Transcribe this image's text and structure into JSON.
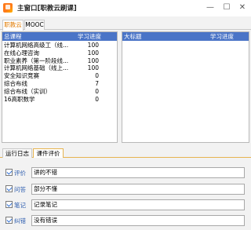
{
  "window": {
    "title": "主窗口[职教云刷课]",
    "controls": {
      "minimize": "—",
      "maximize": "☐",
      "close": "✕"
    }
  },
  "top_tabs": [
    {
      "label": "职教云",
      "active": true
    },
    {
      "label": "MOOC",
      "active": false
    }
  ],
  "course_table": {
    "columns": [
      "总课程",
      "学习进度"
    ],
    "rows": [
      {
        "name": "计算机网络高级工（线...",
        "progress": "100"
      },
      {
        "name": "在线心理咨询",
        "progress": "100"
      },
      {
        "name": "职业素养（第一阶段线...",
        "progress": "100"
      },
      {
        "name": "计算机网络基础（线上...",
        "progress": "100"
      },
      {
        "name": "安全知识竞赛",
        "progress": "0"
      },
      {
        "name": "综合布线",
        "progress": "7"
      },
      {
        "name": "综合布线（实训）",
        "progress": "0"
      },
      {
        "name": "16高职数学",
        "progress": "0"
      }
    ]
  },
  "chapter_table": {
    "columns": [
      "大标题",
      "学习进度"
    ]
  },
  "bottom_tabs": [
    {
      "label": "运行日志",
      "active": false
    },
    {
      "label": "课件评价",
      "active": true
    }
  ],
  "evaluation": [
    {
      "label": "评价",
      "checked": true,
      "value": "讲的不错"
    },
    {
      "label": "问答",
      "checked": true,
      "value": "部分不懂"
    },
    {
      "label": "笔记",
      "checked": true,
      "value": "记录笔记"
    },
    {
      "label": "纠错",
      "checked": true,
      "value": "没有错误"
    }
  ],
  "colors": {
    "header_blue": "#4a74c7",
    "accent_orange": "#e07a00",
    "label_blue": "#2f5fb0"
  }
}
